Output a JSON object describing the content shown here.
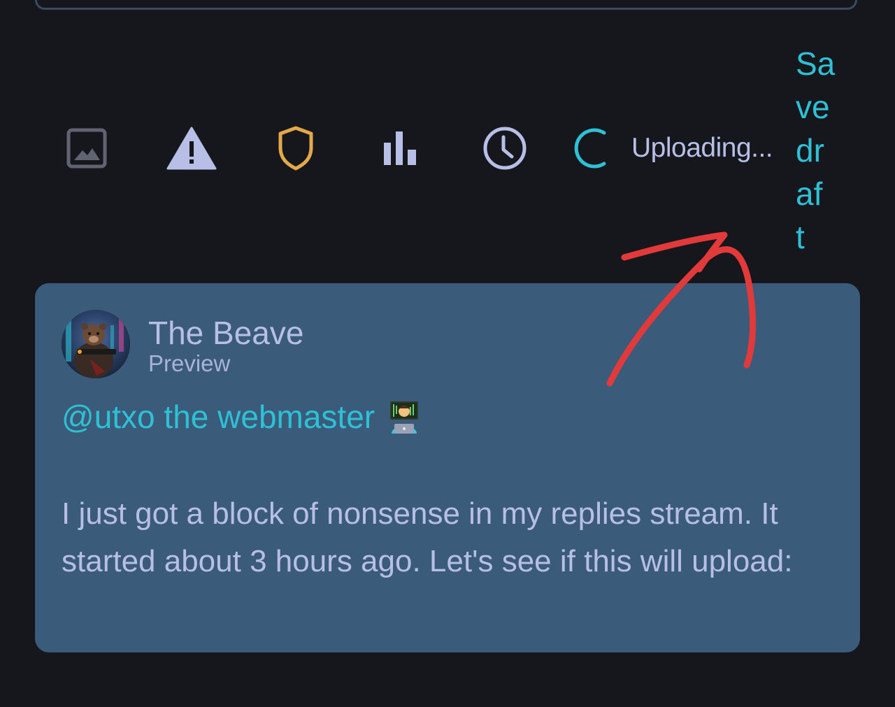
{
  "toolbar": {
    "icons": [
      "image-icon",
      "warning-icon",
      "shield-icon",
      "poll-icon",
      "clock-icon",
      "loading-spinner-icon"
    ],
    "status_text": "Uploading...",
    "save_draft_lines": [
      "Sa",
      "ve",
      "dr",
      "af",
      "t"
    ]
  },
  "preview": {
    "author_name": "The Beave",
    "author_subtitle": "Preview",
    "mention_text": "@utxo the webmaster",
    "emoji": "technologist-emoji",
    "body_text": "I just got a block of nonsense in my replies stream. It started about 3 hours ago. Let's see if this will upload:"
  },
  "colors": {
    "background": "#16171c",
    "card": "#3b5b7a",
    "accent": "#2ec1d6",
    "text": "#b7bfe7",
    "shield": "#e2a84a",
    "annotation_arrow": "#e23a3a"
  }
}
